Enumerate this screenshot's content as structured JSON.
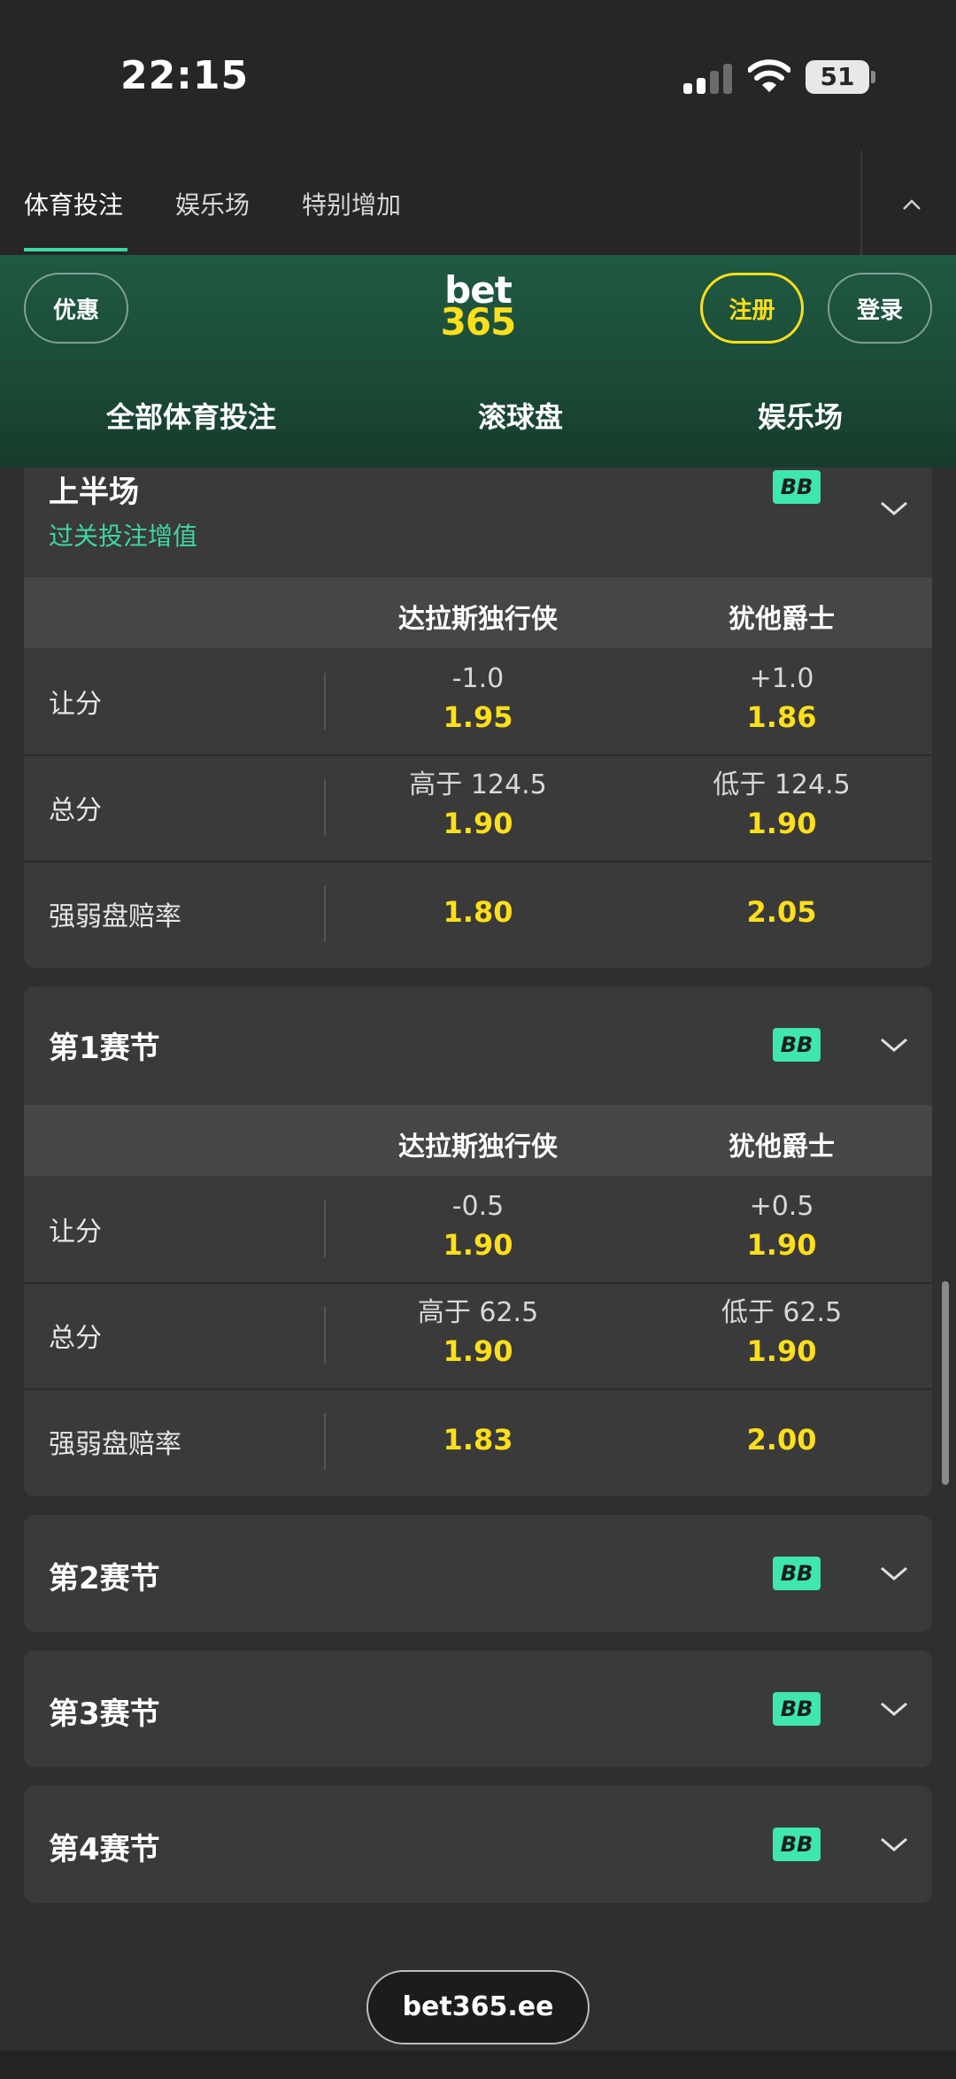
{
  "status": {
    "time": "22:15",
    "battery": "51"
  },
  "top_nav": {
    "tabs": [
      "体育投注",
      "娱乐场",
      "特别增加"
    ]
  },
  "header": {
    "promo": "优惠",
    "logo_top": "bet",
    "logo_bottom": "365",
    "register": "注册",
    "login": "登录",
    "links": [
      "全部体育投注",
      "滚球盘",
      "娱乐场"
    ]
  },
  "sections": {
    "first_half": {
      "title": "上半场",
      "subtitle": "过关投注增值",
      "badge": "BB",
      "team_a": "达拉斯独行侠",
      "team_b": "犹他爵士",
      "rows": [
        {
          "label": "让分",
          "a_line": "-1.0",
          "a_odds": "1.95",
          "b_line": "+1.0",
          "b_odds": "1.86"
        },
        {
          "label": "总分",
          "a_line": "高于 124.5",
          "a_odds": "1.90",
          "b_line": "低于 124.5",
          "b_odds": "1.90"
        },
        {
          "label": "强弱盘赔率",
          "a_odds": "1.80",
          "b_odds": "2.05"
        }
      ]
    },
    "q1": {
      "title": "第1赛节",
      "badge": "BB",
      "team_a": "达拉斯独行侠",
      "team_b": "犹他爵士",
      "rows": [
        {
          "label": "让分",
          "a_line": "-0.5",
          "a_odds": "1.90",
          "b_line": "+0.5",
          "b_odds": "1.90"
        },
        {
          "label": "总分",
          "a_line": "高于 62.5",
          "a_odds": "1.90",
          "b_line": "低于 62.5",
          "b_odds": "1.90"
        },
        {
          "label": "强弱盘赔率",
          "a_odds": "1.83",
          "b_odds": "2.00"
        }
      ]
    },
    "q2": {
      "title": "第2赛节",
      "badge": "BB"
    },
    "q3": {
      "title": "第3赛节",
      "badge": "BB"
    },
    "q4": {
      "title": "第4赛节",
      "badge": "BB"
    }
  },
  "footer": {
    "domain": "bet365.ee"
  },
  "colors": {
    "accent_green": "#3fd6a6",
    "odds_yellow": "#ffdf1b",
    "header_green": "#1f5a43"
  },
  "icons": [
    "signal-icon",
    "wifi-icon",
    "battery-icon",
    "chevron-up-icon",
    "chevron-down-icon"
  ]
}
